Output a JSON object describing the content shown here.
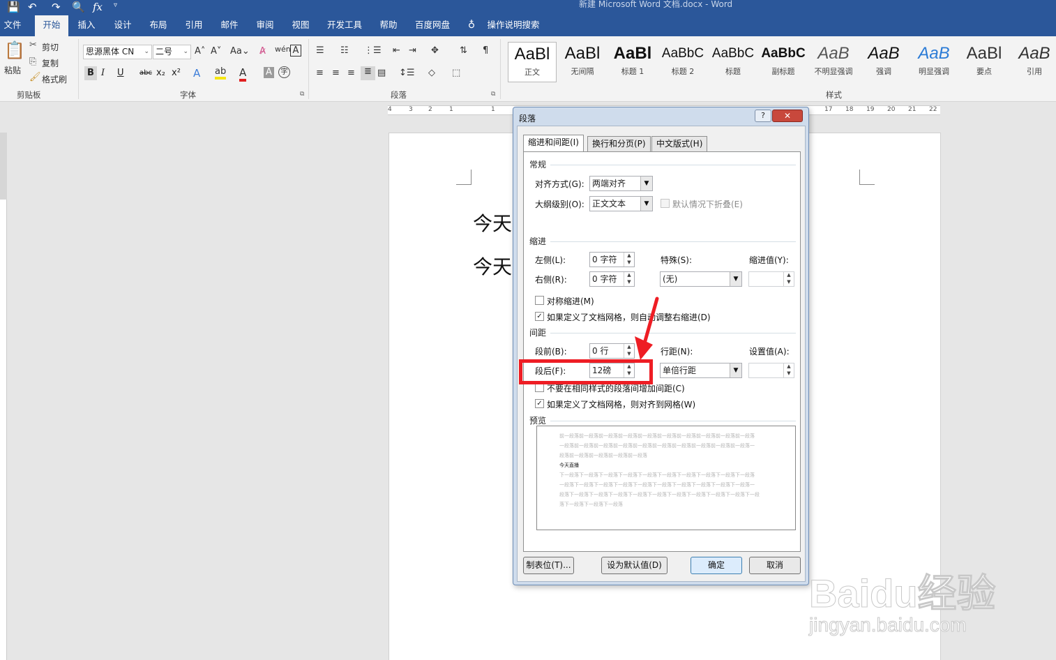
{
  "titlebar": {
    "doc_title": "新建 Microsoft Word 文档.docx  -  Word"
  },
  "tabs": [
    "文件",
    "开始",
    "插入",
    "设计",
    "布局",
    "引用",
    "邮件",
    "审阅",
    "视图",
    "开发工具",
    "帮助",
    "百度网盘"
  ],
  "tell_me": "操作说明搜索",
  "ribbon": {
    "clipboard": {
      "paste": "粘贴",
      "cut": "剪切",
      "copy": "复制",
      "format_painter": "格式刷",
      "label": "剪贴板"
    },
    "font": {
      "name": "思源黑体 CN",
      "size": "二号",
      "label": "字体",
      "bold": "B",
      "italic": "I",
      "underline": "U",
      "strike": "abc",
      "sub": "x₂",
      "sup": "x²",
      "case": "Aa"
    },
    "paragraph": {
      "label": "段落"
    },
    "styles": {
      "label": "样式",
      "items": [
        {
          "sample": "AaBl",
          "name": "正文"
        },
        {
          "sample": "AaBl",
          "name": "无间隔"
        },
        {
          "sample": "AaBl",
          "name": "标题 1"
        },
        {
          "sample": "AaBbC",
          "name": "标题 2"
        },
        {
          "sample": "AaBbC",
          "name": "标题"
        },
        {
          "sample": "AaBbC",
          "name": "副标题"
        },
        {
          "sample": "AaB",
          "name": "不明显强调"
        },
        {
          "sample": "AaB",
          "name": "强调"
        },
        {
          "sample": "AaB",
          "name": "明显强调"
        },
        {
          "sample": "AaBl",
          "name": "要点"
        },
        {
          "sample": "AaB",
          "name": "引用"
        }
      ]
    }
  },
  "ruler": {
    "left_nums": [
      "4",
      "3",
      "2",
      "1",
      "1"
    ],
    "right_nums": [
      "17",
      "18",
      "19",
      "20",
      "21",
      "22"
    ]
  },
  "document": {
    "line1": "今天",
    "line2": "今天"
  },
  "dialog": {
    "title": "段落",
    "help": "?",
    "close": "✕",
    "tabs": [
      "缩进和间距(I)",
      "换行和分页(P)",
      "中文版式(H)"
    ],
    "general": {
      "section": "常规",
      "align_label": "对齐方式(G):",
      "align_value": "两端对齐",
      "outline_label": "大纲级别(O):",
      "outline_value": "正文文本",
      "collapse_label": "默认情况下折叠(E)"
    },
    "indent": {
      "section": "缩进",
      "left_label": "左侧(L):",
      "left_value": "0 字符",
      "right_label": "右侧(R):",
      "right_value": "0 字符",
      "special_label": "特殊(S):",
      "special_value": "(无)",
      "by_label": "缩进值(Y):",
      "mirror_label": "对称缩进(M)",
      "auto_right_label": "如果定义了文档网格，则自动调整右缩进(D)"
    },
    "spacing": {
      "section": "间距",
      "before_label": "段前(B):",
      "before_value": "0 行",
      "after_label": "段后(F):",
      "after_value": "12磅",
      "line_label": "行距(N):",
      "line_value": "单倍行距",
      "at_label": "设置值(A):",
      "no_space_label": "不要在相同样式的段落间增加间距(C)",
      "snap_label": "如果定义了文档网格，则对齐到网格(W)"
    },
    "preview": {
      "section": "预览",
      "prev_lines": [
        "前一段落前一段落前一段落前一段落前一段落前一段落前一段落前一段落前一段落前一段落",
        "一段落前一段落前一段落前一段落前一段落前一段落前一段落前一段落前一段落前一段落一",
        "段落前一段落前一段落前一段落前一段落"
      ],
      "current": "今天直播",
      "next_lines": [
        "下一段落下一段落下一段落下一段落下一段落下一段落下一段落下一段落下一段落下一段落",
        "一段落下一段落下一段落下一段落下一段落下一段落下一段落下一段落下一段落下一段落一",
        "段落下一段落下一段落下一段落下一段落下一段落下一段落下一段落下一段落下一段落下一段",
        "落下一段落下一段落下一段落"
      ]
    },
    "buttons": {
      "tabs": "制表位(T)...",
      "default": "设为默认值(D)",
      "ok": "确定",
      "cancel": "取消"
    }
  },
  "watermark": {
    "brand": "Baidu经验",
    "url": "jingyan.baidu.com"
  },
  "colors": {
    "brand": "#2b579a",
    "annotation": "#ee1d24"
  }
}
